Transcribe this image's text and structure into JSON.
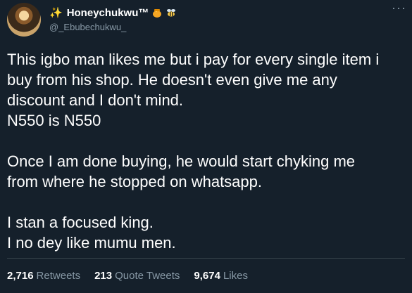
{
  "user": {
    "display_name": "Honeychukwu™",
    "handle": "@_Ebubechukwu_"
  },
  "tweet": {
    "lines": [
      "This igbo man likes me but i pay for every single item i",
      "buy from his shop. He doesn't even give me any",
      "discount and I don't mind.",
      "N550 is N550",
      "",
      "Once I am done buying, he would start chyking me",
      "from where he stopped on whatsapp.",
      "",
      "I stan a focused king.",
      "I no dey like mumu men."
    ]
  },
  "stats": {
    "retweets_count": "2,716",
    "retweets_label": "Retweets",
    "quotes_count": "213",
    "quotes_label": "Quote Tweets",
    "likes_count": "9,674",
    "likes_label": "Likes"
  },
  "colors": {
    "background": "#15202b",
    "secondary_text": "#8899a6",
    "divider": "#38444d"
  },
  "icons": [
    "sparkles-icon",
    "honey-pot-icon",
    "bee-icon",
    "more-options-icon"
  ]
}
